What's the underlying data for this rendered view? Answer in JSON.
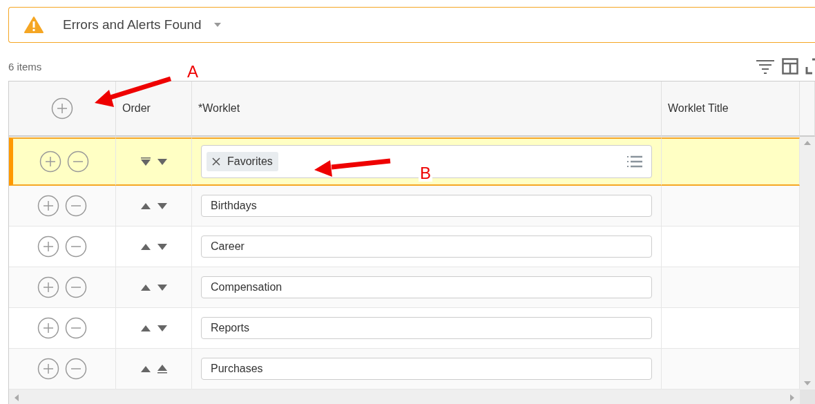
{
  "alert": {
    "title": "Errors and Alerts Found"
  },
  "item_count": "6 items",
  "table": {
    "columns": [
      {
        "kind": "add"
      },
      {
        "kind": "text",
        "label": "Order"
      },
      {
        "kind": "text",
        "label": "*Worklet"
      },
      {
        "kind": "text",
        "label": "Worklet Title"
      }
    ],
    "rows": [
      {
        "selected": true,
        "order": [
          {
            "kind": "down-bar"
          },
          {
            "kind": "down"
          }
        ],
        "worklet": {
          "kind": "tag",
          "value": "Favorites"
        }
      },
      {
        "selected": false,
        "order": [
          {
            "kind": "up"
          },
          {
            "kind": "down"
          }
        ],
        "worklet": {
          "kind": "text",
          "value": "Birthdays"
        }
      },
      {
        "selected": false,
        "order": [
          {
            "kind": "up"
          },
          {
            "kind": "down"
          }
        ],
        "worklet": {
          "kind": "text",
          "value": "Career"
        }
      },
      {
        "selected": false,
        "order": [
          {
            "kind": "up"
          },
          {
            "kind": "down"
          }
        ],
        "worklet": {
          "kind": "text",
          "value": "Compensation"
        }
      },
      {
        "selected": false,
        "order": [
          {
            "kind": "up"
          },
          {
            "kind": "down"
          }
        ],
        "worklet": {
          "kind": "text",
          "value": "Reports"
        }
      },
      {
        "selected": false,
        "order": [
          {
            "kind": "up"
          },
          {
            "kind": "up-bar"
          }
        ],
        "worklet": {
          "kind": "text",
          "value": "Purchases"
        }
      }
    ]
  },
  "annotations": [
    {
      "label": "A",
      "kind": "header"
    },
    {
      "label": "B",
      "kind": "tag"
    }
  ]
}
